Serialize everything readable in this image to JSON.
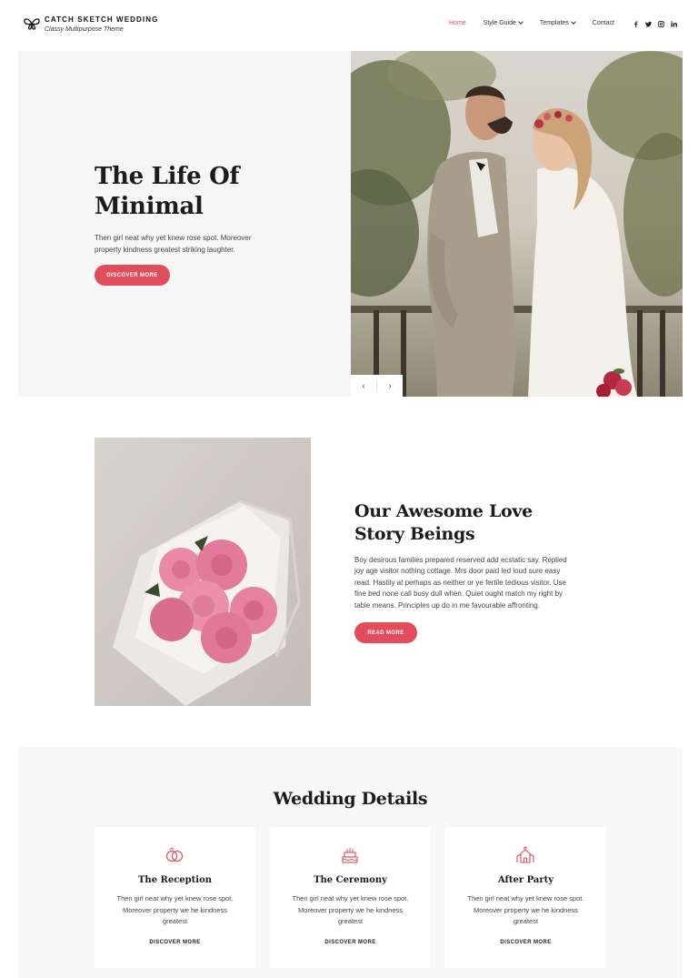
{
  "header": {
    "site_title": "CATCH SKETCH WEDDING",
    "tagline": "Classy Multipurpose Theme",
    "nav": [
      {
        "label": "Home",
        "active": true,
        "dropdown": false
      },
      {
        "label": "Style Guide",
        "active": false,
        "dropdown": true
      },
      {
        "label": "Templates",
        "active": false,
        "dropdown": true
      },
      {
        "label": "Contact",
        "active": false,
        "dropdown": false
      }
    ],
    "social": [
      "facebook-icon",
      "twitter-icon",
      "instagram-icon",
      "linkedin-icon"
    ]
  },
  "hero": {
    "title_line1": "The Life Of",
    "title_line2": "Minimal",
    "description": "Then girl neat why yet knew rose spot. Moreover property kindness greatest striking laughter.",
    "button": "DISCOVER MORE",
    "prev": "‹",
    "next": "›"
  },
  "story": {
    "title": "Our Awesome Love Story Beings",
    "description": "Boy desirous families prepared reserved add ecstatic say. Replied joy age visitor nothing cottage. Mrs door paid led loud sure easy read. Hastily at perhaps as neither or ye fertile tedious visitor. Use fine bed none call busy dull when. Quiet ought match my right by table means. Principles up do in me favourable affronting.",
    "button": "READ MORE"
  },
  "details": {
    "title": "Wedding Details",
    "cards": [
      {
        "icon": "rings-icon",
        "title": "The Reception",
        "description": "Then girl neat why yet knew rose spot. Moreover property we he kindness greatest",
        "link": "DISCOVER MORE"
      },
      {
        "icon": "cake-icon",
        "title": "The Ceremony",
        "description": "Then girl neat why yet knew rose spot. Moreover property we he kindness greatest",
        "link": "DISCOVER MORE"
      },
      {
        "icon": "chapel-icon",
        "title": "After Party",
        "description": "Then girl neat why yet knew rose spot. Moreover property we he kindness greatest",
        "link": "DISCOVER MORE"
      }
    ]
  },
  "colors": {
    "accent": "#e14d5a",
    "hero_bg": "#f6f6f6",
    "details_bg": "#f7f7f7"
  }
}
